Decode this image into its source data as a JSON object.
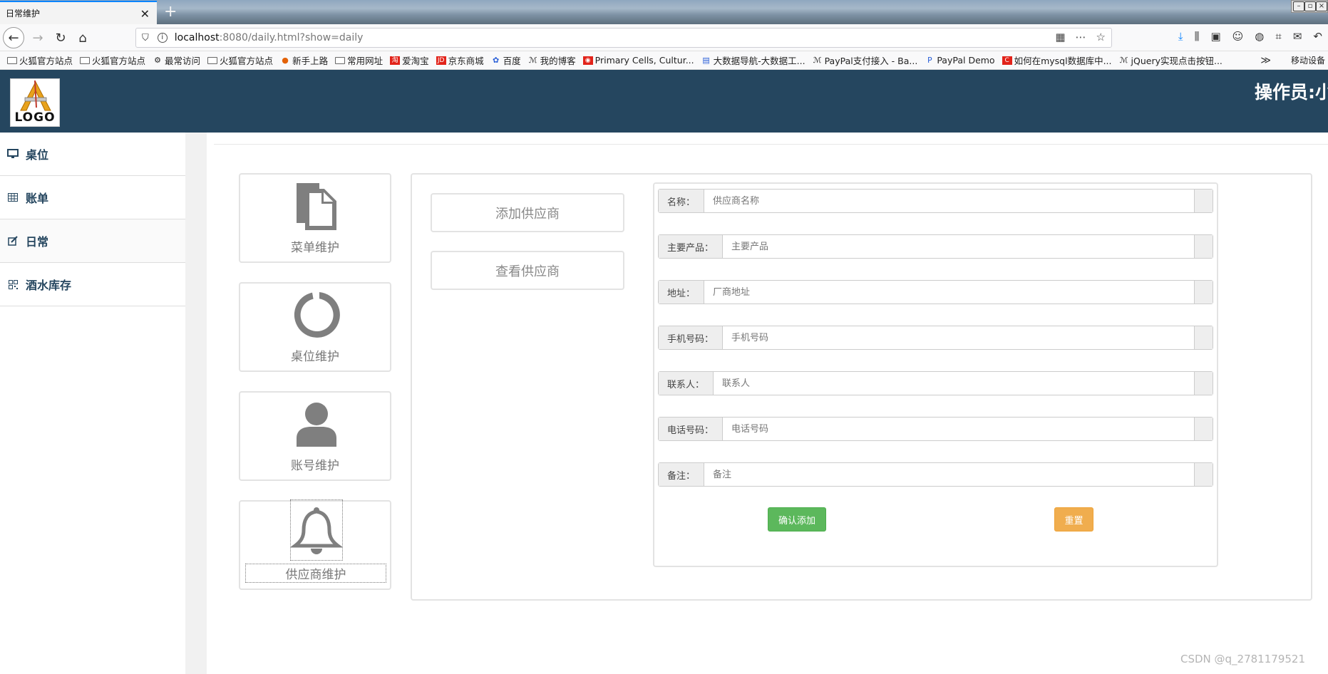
{
  "browser": {
    "tab_title": "日常维护",
    "tab_close": "✕",
    "new_tab": "+",
    "url_host": "localhost",
    "url_path": ":8080/daily.html?show=daily",
    "bookmarks": [
      {
        "label": "火狐官方站点",
        "icon": "folder-icon"
      },
      {
        "label": "火狐官方站点",
        "icon": "folder-icon"
      },
      {
        "label": "最常访问",
        "icon": "gear-icon"
      },
      {
        "label": "火狐官方站点",
        "icon": "folder-icon"
      },
      {
        "label": "新手上路",
        "icon": "firefox-icon"
      },
      {
        "label": "常用网址",
        "icon": "folder-icon"
      },
      {
        "label": "爱淘宝",
        "icon": "taobao-icon"
      },
      {
        "label": "京东商城",
        "icon": "jd-icon"
      },
      {
        "label": "百度",
        "icon": "baidu-paw-icon"
      },
      {
        "label": "我的博客",
        "icon": "blog-icon"
      },
      {
        "label": "Primary Cells, Cultur...",
        "icon": "site-icon"
      },
      {
        "label": "大数据导航-大数据工...",
        "icon": "site-icon"
      },
      {
        "label": "PayPal支付接入 - Ba...",
        "icon": "blog-icon"
      },
      {
        "label": "PayPal Demo",
        "icon": "paypal-icon"
      },
      {
        "label": "如何在mysql数据库中...",
        "icon": "csdn-icon"
      },
      {
        "label": "jQuery实现点击按钮...",
        "icon": "blog-icon"
      }
    ],
    "bookmarks_more": "≫",
    "mobile_bookmarks": "移动设备",
    "colors": {
      "tab_accent": "#0a84ff"
    }
  },
  "header": {
    "logo_text": "LOGO",
    "operator": "操作员:小",
    "colors": {
      "bg": "#25465f"
    }
  },
  "sidebar": {
    "items": [
      {
        "label": "桌位",
        "icon": "monitor-icon"
      },
      {
        "label": "账单",
        "icon": "table-icon"
      },
      {
        "label": "日常",
        "icon": "edit-icon"
      },
      {
        "label": "酒水库存",
        "icon": "qrcode-icon"
      }
    ]
  },
  "tiles": [
    {
      "label": "菜单维护",
      "icon": "file-icon"
    },
    {
      "label": "桌位维护",
      "icon": "circle-notch-icon"
    },
    {
      "label": "账号维护",
      "icon": "user-icon"
    },
    {
      "label": "供应商维护",
      "icon": "bell-icon"
    }
  ],
  "supplier_actions": {
    "add": "添加供应商",
    "view": "查看供应商"
  },
  "form": {
    "fields": [
      {
        "label": "名称：",
        "placeholder": "供应商名称"
      },
      {
        "label": "主要产品：",
        "placeholder": "主要产品"
      },
      {
        "label": "地址：",
        "placeholder": "厂商地址"
      },
      {
        "label": "手机号码：",
        "placeholder": "手机号码"
      },
      {
        "label": "联系人：",
        "placeholder": "联系人"
      },
      {
        "label": "电话号码：",
        "placeholder": "电话号码"
      },
      {
        "label": "备注：",
        "placeholder": "备注"
      }
    ],
    "submit": "确认添加",
    "reset": "重置",
    "colors": {
      "submit": "#5cb85c",
      "reset": "#f0ad4e"
    }
  },
  "watermark": "CSDN @q_2781179521"
}
